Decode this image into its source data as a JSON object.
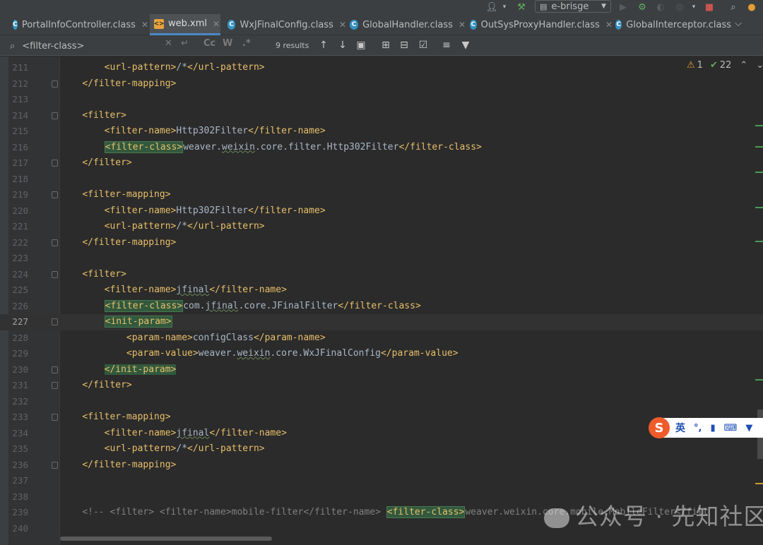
{
  "toolbar": {
    "run_config": "e-brisge",
    "colors": {
      "run": "#499c54",
      "debug": "#5fae5f",
      "stop": "#c75450",
      "update": "#e0a030",
      "build": "#5fae5f"
    }
  },
  "tabs": [
    {
      "label": "PortalInfoController.class",
      "icon": "class-icon",
      "active": false
    },
    {
      "label": "web.xml",
      "icon": "xml-file-icon",
      "active": true
    },
    {
      "label": "WxJFinalConfig.class",
      "icon": "class-icon",
      "active": false
    },
    {
      "label": "GlobalHandler.class",
      "icon": "class-icon",
      "active": false
    },
    {
      "label": "OutSysProxyHandler.class",
      "icon": "class-icon",
      "active": false
    },
    {
      "label": "GlobalInterceptor.class",
      "icon": "class-icon",
      "active": false
    }
  ],
  "find": {
    "query": "<filter-class>",
    "match_case": "Cc",
    "whole_words": "W",
    "regex": ".*",
    "results": "9 results"
  },
  "inspections": {
    "warnings": "1",
    "ok": "22"
  },
  "editor": {
    "current_line": "227",
    "lines": [
      {
        "n": "211",
        "fold": false
      },
      {
        "n": "212",
        "fold": true
      },
      {
        "n": "213",
        "fold": false
      },
      {
        "n": "214",
        "fold": true
      },
      {
        "n": "215",
        "fold": false
      },
      {
        "n": "216",
        "fold": false
      },
      {
        "n": "217",
        "fold": true
      },
      {
        "n": "218",
        "fold": false
      },
      {
        "n": "219",
        "fold": true
      },
      {
        "n": "220",
        "fold": false
      },
      {
        "n": "221",
        "fold": false
      },
      {
        "n": "222",
        "fold": true
      },
      {
        "n": "223",
        "fold": false
      },
      {
        "n": "224",
        "fold": true
      },
      {
        "n": "225",
        "fold": false
      },
      {
        "n": "226",
        "fold": false
      },
      {
        "n": "227",
        "fold": true
      },
      {
        "n": "228",
        "fold": false
      },
      {
        "n": "229",
        "fold": false
      },
      {
        "n": "230",
        "fold": true
      },
      {
        "n": "231",
        "fold": true
      },
      {
        "n": "232",
        "fold": false
      },
      {
        "n": "233",
        "fold": true
      },
      {
        "n": "234",
        "fold": false
      },
      {
        "n": "235",
        "fold": false
      },
      {
        "n": "236",
        "fold": true
      },
      {
        "n": "237",
        "fold": false
      },
      {
        "n": "238",
        "fold": false
      },
      {
        "n": "239",
        "fold": false
      },
      {
        "n": "240",
        "fold": false
      }
    ],
    "code": {
      "l211_open": "<url-pattern>",
      "l211_text": "/*",
      "l211_close": "</url-pattern>",
      "l212": "</filter-mapping>",
      "l214": "<filter>",
      "l215_open": "<filter-name>",
      "l215_text": "Http302Filter",
      "l215_close": "</filter-name>",
      "l216_open": "<filter-class>",
      "l216_t1": "weaver.",
      "l216_t2": "weixin",
      "l216_t3": ".core.filter.Http302Filter",
      "l216_close": "</filter-class>",
      "l217": "</filter>",
      "l219": "<filter-mapping>",
      "l220_open": "<filter-name>",
      "l220_text": "Http302Filter",
      "l220_close": "</filter-name>",
      "l221_open": "<url-pattern>",
      "l221_text": "/*",
      "l221_close": "</url-pattern>",
      "l222": "</filter-mapping>",
      "l224": "<filter>",
      "l225_open": "<filter-name>",
      "l225_text": "jfinal",
      "l225_close": "</filter-name>",
      "l226_open": "<filter-class>",
      "l226_t1": "com.",
      "l226_t2": "jfinal",
      "l226_t3": ".core.JFinalFilter",
      "l226_close": "</filter-class>",
      "l227": "<init-param>",
      "l228_open": "<param-name>",
      "l228_text": "configClass",
      "l228_close": "</param-name>",
      "l229_open": "<param-value>",
      "l229_t1": "weaver.",
      "l229_t2": "weixin",
      "l229_t3": ".core.WxJFinalConfig",
      "l229_close": "</param-value>",
      "l230": "</init-param>",
      "l231": "</filter>",
      "l233": "<filter-mapping>",
      "l234_open": "<filter-name>",
      "l234_text": "jfinal",
      "l234_close": "</filter-name>",
      "l235_open": "<url-pattern>",
      "l235_text": "/*",
      "l235_close": "</url-pattern>",
      "l236": "</filter-mapping>",
      "l239_a": "<!-- <filter> <filter-name>mobile-filter</filter-name> ",
      "l239_hl": "<filter-class>",
      "l239_b": "weaver.weixin.core.mobile.MobileFilter</filt"
    }
  },
  "ime": {
    "mode": "英",
    "logo": "S"
  },
  "watermark": "公众号 · 先知社区"
}
